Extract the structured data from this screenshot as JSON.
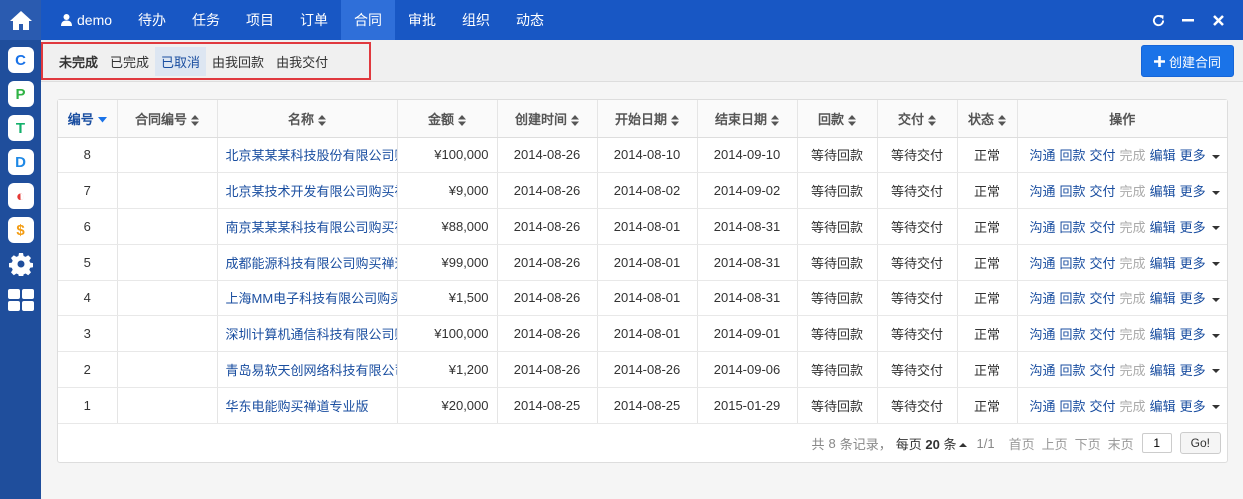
{
  "nav": {
    "user": "demo",
    "items": [
      "待办",
      "任务",
      "项目",
      "订单",
      "合同",
      "审批",
      "组织",
      "动态"
    ],
    "active_index": 4
  },
  "rail": {
    "apps": [
      {
        "letter": "C",
        "color": "#1a73e8"
      },
      {
        "letter": "P",
        "color": "#2fb344"
      },
      {
        "letter": "T",
        "color": "#13b06b"
      },
      {
        "letter": "D",
        "color": "#1e88e5"
      },
      {
        "letter": "◐",
        "color": "#e53935"
      },
      {
        "letter": "$",
        "color": "#f39c12"
      }
    ]
  },
  "filters": {
    "items": [
      "未完成",
      "已完成",
      "已取消",
      "由我回款",
      "由我交付"
    ],
    "bold_index": 0,
    "active_index": 2
  },
  "toolbar": {
    "create_label": "创建合同"
  },
  "table": {
    "headers": [
      "编号",
      "合同编号",
      "名称",
      "金额",
      "创建时间",
      "开始日期",
      "结束日期",
      "回款",
      "交付",
      "状态",
      "操作"
    ],
    "ops": [
      "沟通",
      "回款",
      "交付",
      "完成",
      "编辑",
      "更多"
    ],
    "rows": [
      {
        "id": "8",
        "code": "",
        "name": "北京某某某科技股份有限公司购",
        "amount": "¥100,000",
        "created": "2014-08-26",
        "start": "2014-08-10",
        "end": "2014-09-10",
        "payment": "等待回款",
        "delivery": "等待交付",
        "status": "正常"
      },
      {
        "id": "7",
        "code": "",
        "name": "北京某技术开发有限公司购买禅",
        "amount": "¥9,000",
        "created": "2014-08-26",
        "start": "2014-08-02",
        "end": "2014-09-02",
        "payment": "等待回款",
        "delivery": "等待交付",
        "status": "正常"
      },
      {
        "id": "6",
        "code": "",
        "name": "南京某某某科技有限公司购买禅",
        "amount": "¥88,000",
        "created": "2014-08-26",
        "start": "2014-08-01",
        "end": "2014-08-31",
        "payment": "等待回款",
        "delivery": "等待交付",
        "status": "正常"
      },
      {
        "id": "5",
        "code": "",
        "name": "成都能源科技有限公司购买禅道",
        "amount": "¥99,000",
        "created": "2014-08-26",
        "start": "2014-08-01",
        "end": "2014-08-31",
        "payment": "等待回款",
        "delivery": "等待交付",
        "status": "正常"
      },
      {
        "id": "4",
        "code": "",
        "name": "上海MM电子科技有限公司购买",
        "amount": "¥1,500",
        "created": "2014-08-26",
        "start": "2014-08-01",
        "end": "2014-08-31",
        "payment": "等待回款",
        "delivery": "等待交付",
        "status": "正常"
      },
      {
        "id": "3",
        "code": "",
        "name": "深圳计算机通信科技有限公司购",
        "amount": "¥100,000",
        "created": "2014-08-26",
        "start": "2014-08-01",
        "end": "2014-09-01",
        "payment": "等待回款",
        "delivery": "等待交付",
        "status": "正常"
      },
      {
        "id": "2",
        "code": "",
        "name": "青岛易软天创网络科技有限公司",
        "amount": "¥1,200",
        "created": "2014-08-26",
        "start": "2014-08-26",
        "end": "2014-09-06",
        "payment": "等待回款",
        "delivery": "等待交付",
        "status": "正常"
      },
      {
        "id": "1",
        "code": "",
        "name": "华东电能购买禅道专业版",
        "amount": "¥20,000",
        "created": "2014-08-25",
        "start": "2014-08-25",
        "end": "2015-01-29",
        "payment": "等待回款",
        "delivery": "等待交付",
        "status": "正常"
      }
    ]
  },
  "pager": {
    "total_prefix": "共",
    "total": "8",
    "total_suffix": "条记录，",
    "per_page_prefix": "每页",
    "per_page": "20",
    "per_page_suffix": "条",
    "page_info": "1/1",
    "first": "首页",
    "prev": "上页",
    "next": "下页",
    "last": "末页",
    "page_value": "1",
    "go": "Go!"
  },
  "colors": {
    "rail": "#1f4e9c",
    "topnav": "#1857c4",
    "accent": "#1a73e8",
    "highlight_box": "#e0393e"
  }
}
